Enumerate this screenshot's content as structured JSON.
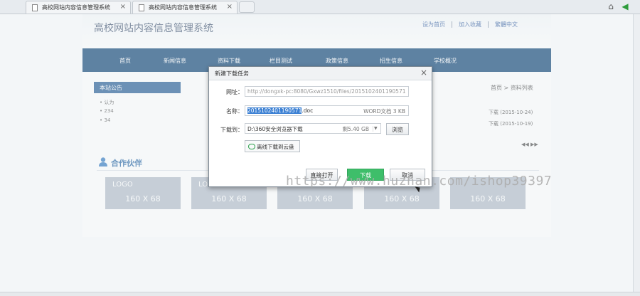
{
  "browser": {
    "tabs": [
      {
        "title": "高校网站内容信息管理系统"
      },
      {
        "title": "高校网站内容信息管理系统"
      }
    ]
  },
  "site": {
    "title": "高校网站内容信息管理系统",
    "top_links": [
      "设为首页",
      "加入收藏",
      "繁體中文"
    ],
    "nav": [
      "首页",
      "新闻信息",
      "资料下载",
      "栏目测试",
      "政策信息",
      "招生信息",
      "学校概况"
    ],
    "notice_title": "本站公告",
    "notices": [
      "认为",
      "234",
      "34"
    ],
    "breadcrumb": "首页 > 资料列表",
    "downloads": [
      "下载 (2015-10-24)",
      "下载 (2015-10-19)"
    ],
    "pager": "◀◀ ▶▶",
    "partners_title": "合作伙伴",
    "logos": [
      {
        "line1": "LOGO",
        "line2": "160 X 68"
      },
      {
        "line1": "LO",
        "line2": "160 X 68"
      },
      {
        "line1": "",
        "line2": "160 X 68"
      },
      {
        "line1": "",
        "line2": "160 X 68"
      },
      {
        "line1": "",
        "line2": "160 X 68"
      }
    ]
  },
  "dialog": {
    "title": "新建下载任务",
    "url_label": "网址：",
    "url_value": "http://dongxk-pc:8080/Gxwz1510/files/2015102401190571",
    "name_label": "名称：",
    "name_selected": "2015102401190571",
    "name_ext": ".doc",
    "file_info": "WORD文档 3 KB",
    "save_label": "下载到：",
    "save_path": "D:\\360安全浏览器下载",
    "free_space": "剩5.40 GB",
    "browse_label": "浏览",
    "cloud_label": "离线下载到云盘",
    "open_label": "直接打开",
    "download_label": "下载",
    "cancel_label": "取消"
  },
  "watermark": "https://www.huzhan.com/ishop39397",
  "colors": {
    "nav_bg": "#164a7a",
    "accent_blue": "#2c6299",
    "download_green": "#3ebe6a"
  }
}
